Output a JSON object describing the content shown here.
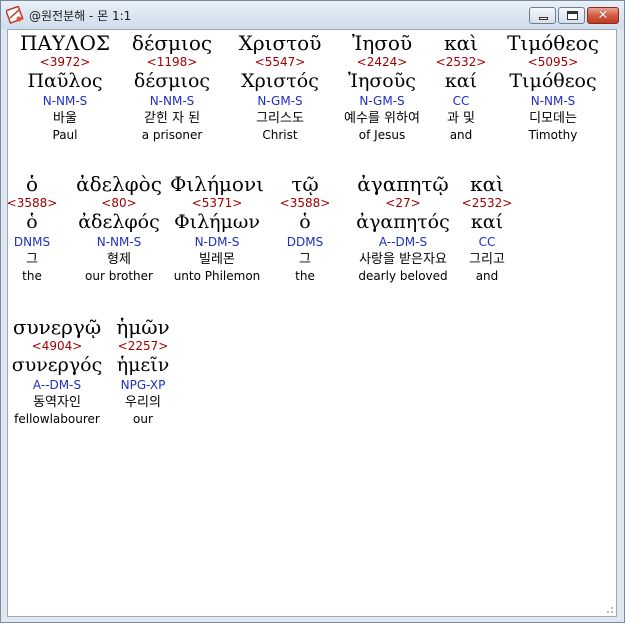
{
  "window": {
    "title": "@원전분해 - 몬 1:1"
  },
  "words": [
    {
      "greek": "ΠΑΥΛΟΣ",
      "strong": "<3972>",
      "lemma": "Παῦλος",
      "parse": "N-NM-S",
      "kor": "바울",
      "eng": "Paul"
    },
    {
      "greek": "δέσμιος",
      "strong": "<1198>",
      "lemma": "δέσμιος",
      "parse": "N-NM-S",
      "kor": "갇힌 자 된",
      "eng": "a prisoner"
    },
    {
      "greek": "Χριστοῦ",
      "strong": "<5547>",
      "lemma": "Χριστός",
      "parse": "N-GM-S",
      "kor": "그리스도",
      "eng": "Christ"
    },
    {
      "greek": "Ἰησοῦ",
      "strong": "<2424>",
      "lemma": "Ἰησοῦς",
      "parse": "N-GM-S",
      "kor": "예수를 위하여",
      "eng": "of Jesus"
    },
    {
      "greek": "καὶ",
      "strong": "<2532>",
      "lemma": "καί",
      "parse": "CC",
      "kor": "과 및",
      "eng": "and"
    },
    {
      "greek": "Τιμόθεος",
      "strong": "<5095>",
      "lemma": "Τιμόθεος",
      "parse": "N-NM-S",
      "kor": "디모데는",
      "eng": "Timothy"
    },
    {
      "greek": "ὁ",
      "strong": "<3588>",
      "lemma": "ὁ",
      "parse": "DNMS",
      "kor": "그",
      "eng": "the"
    },
    {
      "greek": "ἀδελφὸς",
      "strong": "<80>",
      "lemma": "ἀδελφός",
      "parse": "N-NM-S",
      "kor": "형제",
      "eng": "our brother"
    },
    {
      "greek": "Φιλήμονι",
      "strong": "<5371>",
      "lemma": "Φιλήμων",
      "parse": "N-DM-S",
      "kor": "빌레몬",
      "eng": "unto Philemon"
    },
    {
      "greek": "τῷ",
      "strong": "<3588>",
      "lemma": "ὁ",
      "parse": "DDMS",
      "kor": "그",
      "eng": "the"
    },
    {
      "greek": "ἀγαπητῷ",
      "strong": "<27>",
      "lemma": "ἀγαπητός",
      "parse": "A--DM-S",
      "kor": "사랑을 받은자요",
      "eng": "dearly beloved"
    },
    {
      "greek": "καὶ",
      "strong": "<2532>",
      "lemma": "καί",
      "parse": "CC",
      "kor": "그리고",
      "eng": "and"
    },
    {
      "greek": "συνεργῷ",
      "strong": "<4904>",
      "lemma": "συνεργός",
      "parse": "A--DM-S",
      "kor": "동역자인",
      "eng": "fellowlabourer"
    },
    {
      "greek": "ἡμῶν",
      "strong": "<2257>",
      "lemma": "ἡμεῖν",
      "parse": "NPG-XP",
      "kor": "우리의",
      "eng": "our"
    }
  ]
}
